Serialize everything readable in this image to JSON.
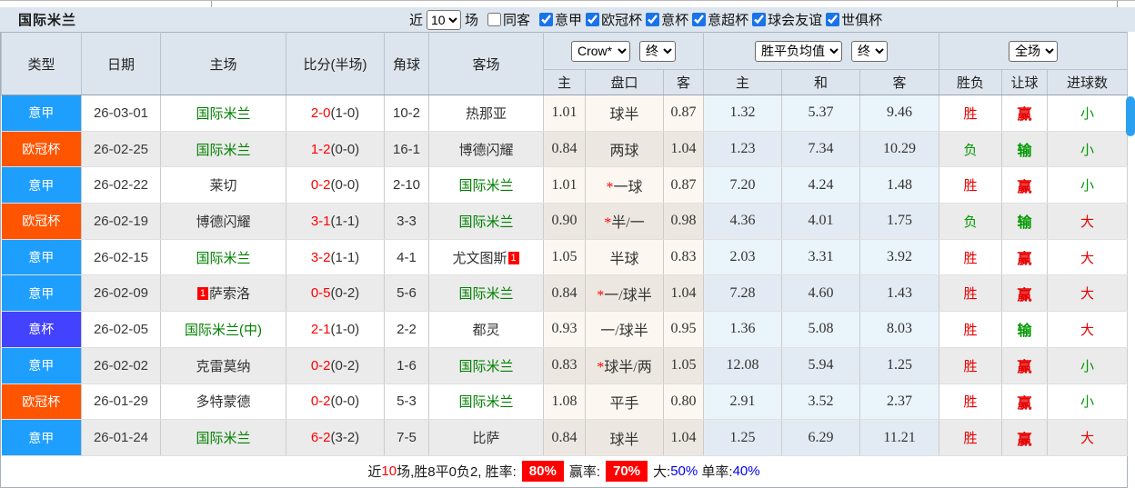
{
  "title": "国际米兰",
  "toolbar": {
    "recent_label": "近",
    "recent_select": "10",
    "games_label": "场",
    "same_away_label": "同客",
    "same_away_checked": false,
    "filters": [
      {
        "label": "意甲",
        "checked": true
      },
      {
        "label": "欧冠杯",
        "checked": true
      },
      {
        "label": "意杯",
        "checked": true
      },
      {
        "label": "意超杯",
        "checked": true
      },
      {
        "label": "球会友谊",
        "checked": true
      },
      {
        "label": "世俱杯",
        "checked": true
      }
    ]
  },
  "table": {
    "headers": {
      "type": "类型",
      "date": "日期",
      "home": "主场",
      "score": "比分(半场)",
      "corner": "角球",
      "away": "客场",
      "odds_home": "主",
      "odds_line": "盘口",
      "odds_away": "客",
      "avg_home": "主",
      "avg_draw": "和",
      "avg_away": "客",
      "result_wl": "胜负",
      "result_handicap": "让球",
      "result_goals": "进球数"
    },
    "selects": {
      "bookmaker": "Crow*",
      "final1": "终",
      "avg": "胜平负均值",
      "final2": "终",
      "fulltime": "全场"
    },
    "rows": [
      {
        "type": "意甲",
        "type_color": "#1e9ffe",
        "date": "26-03-01",
        "home": "国际米兰",
        "home_green": true,
        "score": "2-0",
        "half": "(1-0)",
        "corner": "10-2",
        "away": "热那亚",
        "o1": "1.01",
        "line": "球半",
        "line_star": false,
        "o2": "0.87",
        "a1": "1.32",
        "a2": "5.37",
        "a3": "9.46",
        "wl": "胜",
        "wl_win": true,
        "hc": "赢",
        "hc_win": true,
        "goals": "小",
        "goals_big": false
      },
      {
        "type": "欧冠杯",
        "type_color": "#ff5400",
        "date": "26-02-25",
        "home": "国际米兰",
        "home_green": true,
        "score": "1-2",
        "half": "(0-0)",
        "corner": "16-1",
        "away": "博德闪耀",
        "o1": "0.84",
        "line": "两球",
        "line_star": false,
        "o2": "1.04",
        "a1": "1.23",
        "a2": "7.34",
        "a3": "10.29",
        "wl": "负",
        "wl_win": false,
        "hc": "输",
        "hc_win": false,
        "goals": "小",
        "goals_big": false
      },
      {
        "type": "意甲",
        "type_color": "#1e9ffe",
        "date": "26-02-22",
        "home": "莱切",
        "score": "0-2",
        "half": "(0-0)",
        "corner": "2-10",
        "away": "国际米兰",
        "away_green": true,
        "o1": "1.01",
        "line": "一球",
        "line_star": true,
        "o2": "0.87",
        "a1": "7.20",
        "a2": "4.24",
        "a3": "1.48",
        "wl": "胜",
        "wl_win": true,
        "hc": "赢",
        "hc_win": true,
        "goals": "小",
        "goals_big": false
      },
      {
        "type": "欧冠杯",
        "type_color": "#ff5400",
        "date": "26-02-19",
        "home": "博德闪耀",
        "score": "3-1",
        "half": "(1-1)",
        "corner": "3-3",
        "away": "国际米兰",
        "away_green": true,
        "o1": "0.90",
        "line": "半/一",
        "line_star": true,
        "o2": "0.98",
        "a1": "4.36",
        "a2": "4.01",
        "a3": "1.75",
        "wl": "负",
        "wl_win": false,
        "hc": "输",
        "hc_win": false,
        "goals": "大",
        "goals_big": true
      },
      {
        "type": "意甲",
        "type_color": "#1e9ffe",
        "date": "26-02-15",
        "home": "国际米兰",
        "home_green": true,
        "score": "3-2",
        "half": "(1-1)",
        "corner": "4-1",
        "away": "尤文图斯",
        "away_badge": "1",
        "o1": "1.05",
        "line": "半球",
        "line_star": false,
        "o2": "0.83",
        "a1": "2.03",
        "a2": "3.31",
        "a3": "3.92",
        "wl": "胜",
        "wl_win": true,
        "hc": "赢",
        "hc_win": true,
        "goals": "大",
        "goals_big": true
      },
      {
        "type": "意甲",
        "type_color": "#1e9ffe",
        "date": "26-02-09",
        "home": "萨索洛",
        "home_badge": "1",
        "score": "0-5",
        "half": "(0-2)",
        "corner": "5-6",
        "away": "国际米兰",
        "away_green": true,
        "o1": "0.84",
        "line": "一/球半",
        "line_star": true,
        "o2": "1.04",
        "a1": "7.28",
        "a2": "4.60",
        "a3": "1.43",
        "wl": "胜",
        "wl_win": true,
        "hc": "赢",
        "hc_win": true,
        "goals": "大",
        "goals_big": true
      },
      {
        "type": "意杯",
        "type_color": "#4242ff",
        "date": "26-02-05",
        "home": "国际米兰(中)",
        "home_green": true,
        "score": "2-1",
        "half": "(1-0)",
        "corner": "2-2",
        "away": "都灵",
        "o1": "0.93",
        "line": "一/球半",
        "line_star": false,
        "o2": "0.95",
        "a1": "1.36",
        "a2": "5.08",
        "a3": "8.03",
        "wl": "胜",
        "wl_win": true,
        "hc": "输",
        "hc_win": false,
        "goals": "大",
        "goals_big": true
      },
      {
        "type": "意甲",
        "type_color": "#1e9ffe",
        "date": "26-02-02",
        "home": "克雷莫纳",
        "score": "0-2",
        "half": "(0-2)",
        "corner": "1-6",
        "away": "国际米兰",
        "away_green": true,
        "o1": "0.83",
        "line": "球半/两",
        "line_star": true,
        "o2": "1.05",
        "a1": "12.08",
        "a2": "5.94",
        "a3": "1.25",
        "wl": "胜",
        "wl_win": true,
        "hc": "赢",
        "hc_win": true,
        "goals": "小",
        "goals_big": false
      },
      {
        "type": "欧冠杯",
        "type_color": "#ff5400",
        "date": "26-01-29",
        "home": "多特蒙德",
        "score": "0-2",
        "half": "(0-0)",
        "corner": "5-3",
        "away": "国际米兰",
        "away_green": true,
        "o1": "1.08",
        "line": "平手",
        "line_star": false,
        "o2": "0.80",
        "a1": "2.91",
        "a2": "3.52",
        "a3": "2.37",
        "wl": "胜",
        "wl_win": true,
        "hc": "赢",
        "hc_win": true,
        "goals": "小",
        "goals_big": false
      },
      {
        "type": "意甲",
        "type_color": "#1e9ffe",
        "date": "26-01-24",
        "home": "国际米兰",
        "home_green": true,
        "score": "6-2",
        "half": "(3-2)",
        "corner": "7-5",
        "away": "比萨",
        "o1": "0.84",
        "line": "球半",
        "line_star": false,
        "o2": "1.04",
        "a1": "1.25",
        "a2": "6.29",
        "a3": "11.21",
        "wl": "胜",
        "wl_win": true,
        "hc": "赢",
        "hc_win": true,
        "goals": "大",
        "goals_big": true
      }
    ]
  },
  "footer": {
    "segments": [
      {
        "text": "近",
        "style": "plain"
      },
      {
        "text": "10",
        "style": "red-text"
      },
      {
        "text": "场,胜8平0负2, 胜率:",
        "style": "plain"
      },
      {
        "text": "80%",
        "style": "red-badge"
      },
      {
        "text": "赢率:",
        "style": "plain"
      },
      {
        "text": "70%",
        "style": "red-badge"
      },
      {
        "text": "大:",
        "style": "plain"
      },
      {
        "text": "50%",
        "style": "blue-text"
      },
      {
        "text": " 单率:",
        "style": "plain"
      },
      {
        "text": "40%",
        "style": "blue-text"
      }
    ]
  },
  "colors": {
    "league_serie_a": "#1e9ffe",
    "league_champions": "#ff5400",
    "league_coppa": "#4242ff",
    "win_red": "#e60000",
    "lose_green": "#009900",
    "team_green": "#008000",
    "scrollbar_blue": "#2ba0f0"
  }
}
